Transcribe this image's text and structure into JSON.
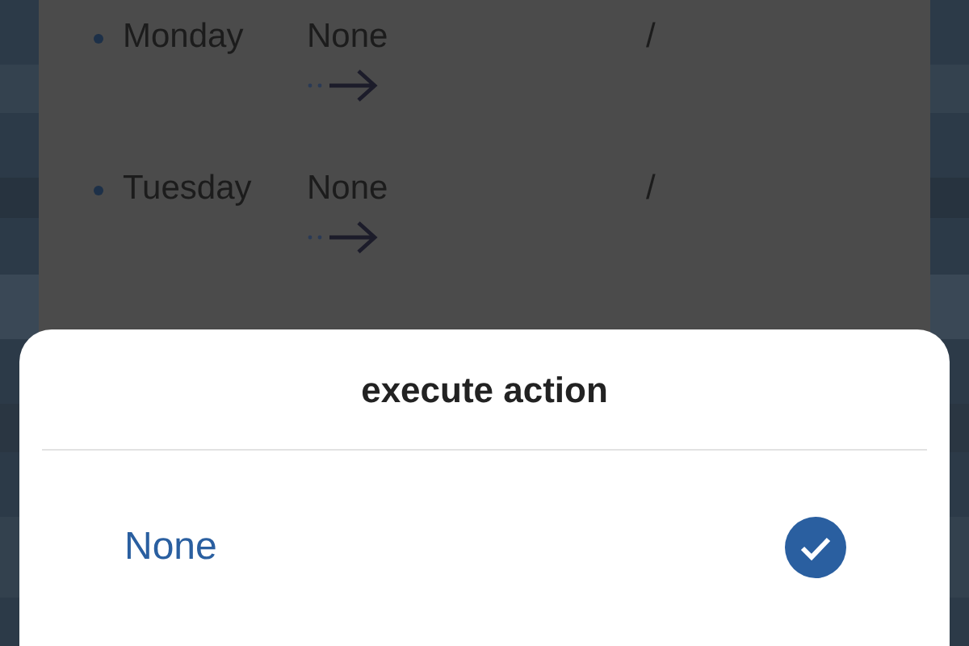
{
  "schedule": [
    {
      "day": "Monday",
      "action": "None",
      "separator": "/"
    },
    {
      "day": "Tuesday",
      "action": "None",
      "separator": "/"
    }
  ],
  "sheet": {
    "title": "execute action",
    "options": [
      {
        "label": "None",
        "selected": true
      }
    ]
  }
}
